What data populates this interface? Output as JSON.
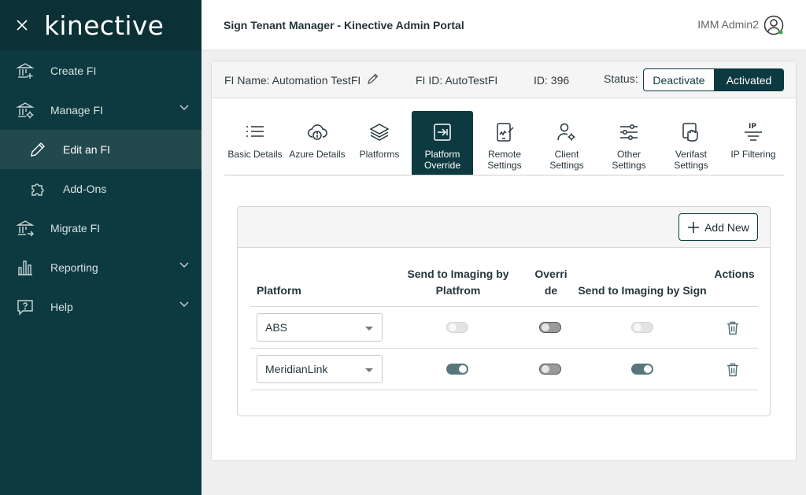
{
  "brand": {
    "logo": "kinective"
  },
  "sidebar": {
    "items": [
      {
        "label": "Create FI",
        "icon": "bank-plus-icon"
      },
      {
        "label": "Manage FI",
        "icon": "bank-gear-icon"
      },
      {
        "label": "Edit an FI",
        "icon": "pencil-icon"
      },
      {
        "label": "Add-Ons",
        "icon": "puzzle-icon"
      },
      {
        "label": "Migrate FI",
        "icon": "bank-arrow-icon"
      },
      {
        "label": "Reporting",
        "icon": "bar-chart-icon"
      },
      {
        "label": "Help",
        "icon": "help-bubble-icon"
      }
    ]
  },
  "header": {
    "title": "Sign Tenant Manager - Kinective Admin Portal",
    "user": "IMM Admin2"
  },
  "fi": {
    "name": "FI Name: Automation TestFI",
    "fi_id": "FI ID: AutoTestFI",
    "id": "ID: 396",
    "status_label": "Status:",
    "deactivate": "Deactivate",
    "activated": "Activated"
  },
  "tabs": [
    {
      "label": "Basic Details",
      "icon": "list-icon"
    },
    {
      "label": "Azure Details",
      "icon": "cloud-info-icon"
    },
    {
      "label": "Platforms",
      "icon": "layers-icon"
    },
    {
      "label": "Platform\nOverride",
      "icon": "override-arrow-icon",
      "active": true
    },
    {
      "label": "Remote\nSettings",
      "icon": "tablet-sign-icon"
    },
    {
      "label": "Client\nSettings",
      "icon": "user-gear-icon"
    },
    {
      "label": "Other\nSettings",
      "icon": "sliders-icon"
    },
    {
      "label": "Verifast\nSettings",
      "icon": "hand-touch-icon"
    },
    {
      "label": "IP Filtering",
      "icon": "ip-filter-icon"
    }
  ],
  "panel": {
    "add_new": "Add New",
    "columns": {
      "platform": "Platform",
      "send_platform": "Send to Imaging by Platfrom",
      "override": "Override",
      "send_sign": "Send to Imaging by Sign",
      "actions": "Actions"
    },
    "rows": [
      {
        "platform": "ABS",
        "send_platform": "off-disabled",
        "override": "off",
        "send_sign": "off-disabled"
      },
      {
        "platform": "MeridianLink",
        "send_platform": "on",
        "override": "off",
        "send_sign": "on"
      }
    ]
  },
  "colors": {
    "sidebar": "#0d3a40",
    "accent": "#0d3a40",
    "toggle_on": "#58777c"
  }
}
